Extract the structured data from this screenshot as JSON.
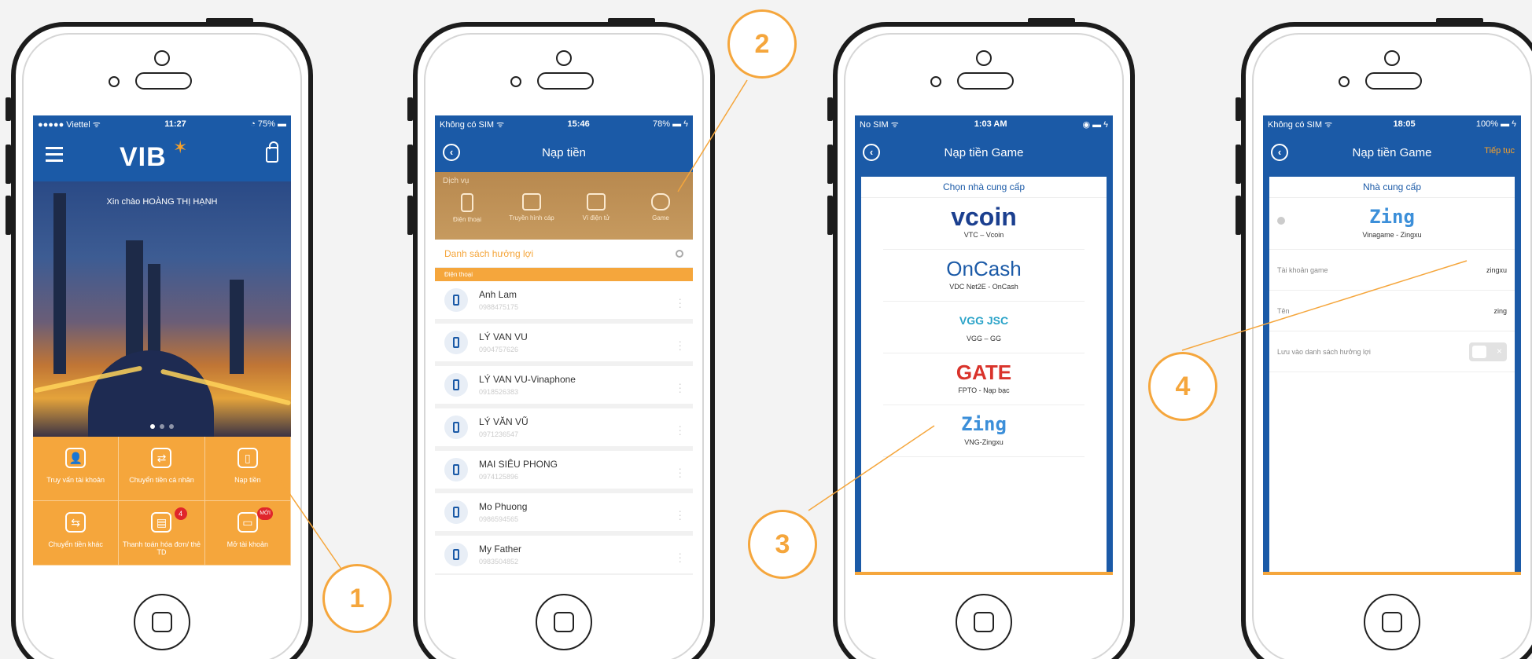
{
  "screen1": {
    "status": {
      "carrier": "●●●●● Viettel ᯤ",
      "time": "11:27",
      "battery": "◔ 75% ▬"
    },
    "logo": "VIB",
    "greeting": "Xin chào HOÀNG THỊ HẠNH",
    "tiles": [
      {
        "label": "Truy vấn tài khoản",
        "icon": "👤"
      },
      {
        "label": "Chuyển tiền cá nhân",
        "icon": "⇄"
      },
      {
        "label": "Nạp tiền",
        "icon": "▯"
      },
      {
        "label": "Chuyển tiền khác",
        "icon": "⇆"
      },
      {
        "label": "Thanh toán hóa đơn/ thẻ TD",
        "icon": "▤",
        "badge": "4"
      },
      {
        "label": "Mở tài khoản",
        "icon": "▭",
        "badge": "MỚI"
      }
    ]
  },
  "screen2": {
    "status": {
      "carrier": "Không có SIM ᯤ",
      "time": "15:46",
      "battery": "78% ▬ ϟ"
    },
    "title": "Nạp tiền",
    "service_heading": "Dịch vụ",
    "services": [
      "Điện thoại",
      "Truyền hình cáp",
      "Ví điện tử",
      "Game"
    ],
    "search_label": "Danh sách hưởng lợi",
    "category": "Điện thoại",
    "contacts": [
      {
        "name": "Anh Lam",
        "number": "0988475175"
      },
      {
        "name": "LÝ VAN VU",
        "number": "0904757626"
      },
      {
        "name": "LÝ VAN VU-Vinaphone",
        "number": "0918526383"
      },
      {
        "name": "LÝ VĂN VŨ",
        "number": "0971236547"
      },
      {
        "name": "MAI SIÊU PHONG",
        "number": "0974125896"
      },
      {
        "name": "Mo Phuong",
        "number": "0986594565"
      },
      {
        "name": "My Father",
        "number": "0983504852"
      }
    ]
  },
  "screen3": {
    "status": {
      "carrier": "No SIM ᯤ",
      "time": "1:03 AM",
      "battery": "◉ ▬ ϟ"
    },
    "title": "Nạp tiền Game",
    "panel_title": "Chọn nhà cung cấp",
    "providers": [
      {
        "logo": "vcoin",
        "name": "VTC – Vcoin",
        "color": "#1b3f8f"
      },
      {
        "logo": "OnCash",
        "name": "VDC Net2E - OnCash",
        "color": "#1b5aa7"
      },
      {
        "logo": "VGG JSC",
        "name": "VGG – GG",
        "color": "#2aa3c8"
      },
      {
        "logo": "GATE",
        "name": "FPTO - Nạp bạc",
        "color": "#d9332b"
      },
      {
        "logo": "Zing",
        "name": "VNG-Zingxu",
        "color": "#3c8fd9"
      }
    ]
  },
  "screen4": {
    "status": {
      "carrier": "Không có SIM ᯤ",
      "time": "18:05",
      "battery": "100% ▬ ϟ"
    },
    "title": "Nạp tiền Game",
    "next": "Tiếp tục",
    "panel_title": "Nhà cung cấp",
    "provider_logo": "Zing",
    "provider_name": "Vinagame - Zingxu",
    "fields": [
      {
        "label": "Tài khoản game",
        "value": "zingxu"
      },
      {
        "label": "Tên",
        "value": "zing"
      }
    ],
    "save_label": "Lưu vào danh sách hưởng lợi"
  },
  "callouts": [
    "1",
    "2",
    "3",
    "4"
  ],
  "colors": {
    "brand_blue": "#1b5aa7",
    "accent_orange": "#f5a63c"
  }
}
